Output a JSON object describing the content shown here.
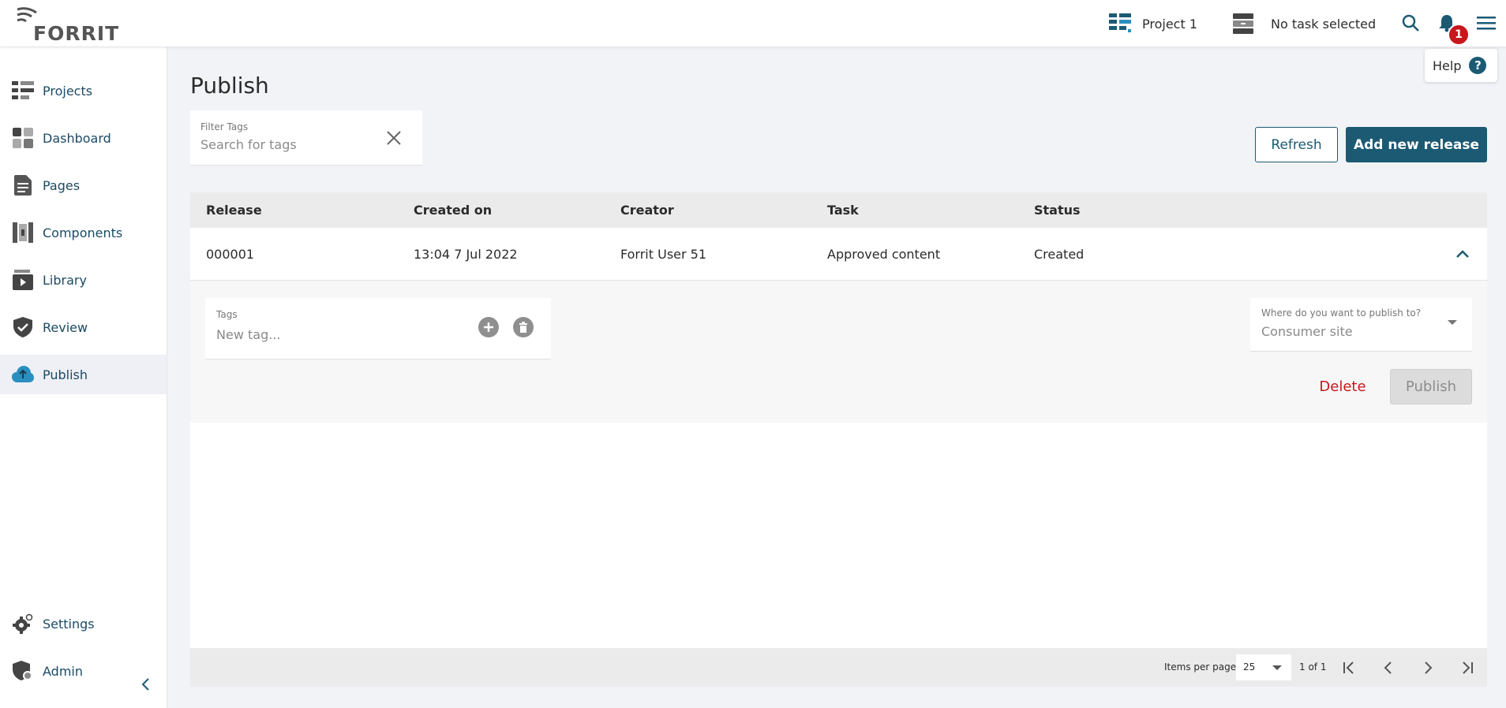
{
  "brand": {
    "name": "FORRIT"
  },
  "topbar": {
    "project_label": "Project 1",
    "task_label": "No task selected",
    "notification_count": "1",
    "help_label": "Help"
  },
  "sidebar": {
    "items": [
      {
        "label": "Projects",
        "icon": "projects-icon"
      },
      {
        "label": "Dashboard",
        "icon": "dashboard-icon"
      },
      {
        "label": "Pages",
        "icon": "pages-icon"
      },
      {
        "label": "Components",
        "icon": "components-icon"
      },
      {
        "label": "Library",
        "icon": "library-icon"
      },
      {
        "label": "Review",
        "icon": "review-icon"
      },
      {
        "label": "Publish",
        "icon": "publish-icon",
        "active": true
      }
    ],
    "bottom_items": [
      {
        "label": "Settings",
        "icon": "settings-icon"
      },
      {
        "label": "Admin",
        "icon": "admin-icon"
      }
    ]
  },
  "main": {
    "title": "Publish",
    "filter": {
      "label": "Filter Tags",
      "placeholder": "Search for tags"
    },
    "refresh_label": "Refresh",
    "add_label": "Add new release"
  },
  "table": {
    "columns": [
      "Release",
      "Created on",
      "Creator",
      "Task",
      "Status"
    ],
    "rows": [
      {
        "release": "000001",
        "created_on": "13:04 7 Jul 2022",
        "creator": "Forrit User 51",
        "task": "Approved content",
        "status": "Created"
      }
    ],
    "expanded": {
      "tags_label": "Tags",
      "tags_placeholder": "New tag...",
      "destination_label": "Where do you want to publish to?",
      "destination_value": "Consumer site",
      "delete_label": "Delete",
      "publish_label": "Publish"
    }
  },
  "pagination": {
    "items_per_page_label": "Items per page",
    "items_per_page": "25",
    "range": "1 of 1"
  },
  "colors": {
    "primary": "#1c5a74",
    "danger": "#c8161d",
    "header_bg": "#ebebec",
    "page_bg": "#f2f3f7"
  }
}
